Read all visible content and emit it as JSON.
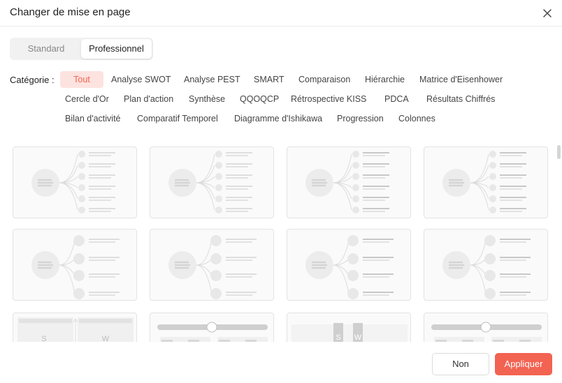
{
  "dialog": {
    "title": "Changer de mise en page"
  },
  "tabs": {
    "standard": "Standard",
    "professional": "Professionnel"
  },
  "categories": {
    "label": "Catégorie",
    "items": [
      "Tout",
      "Analyse SWOT",
      "Analyse PEST",
      "SMART",
      "Comparaison",
      "Hiérarchie",
      "Matrice d'Eisenhower",
      "Cercle d'Or",
      "Plan d'action",
      "Synthèse",
      "QQOQCP",
      "Rétrospective KISS",
      "PDCA",
      "Résultats Chiffrés",
      "Bilan d'activité",
      "Comparatif Temporel",
      "Diagramme d'Ishikawa",
      "Progression",
      "Colonnes"
    ],
    "active": "Tout"
  },
  "thumbnails": {
    "rows": [
      [
        "mindmap-6",
        "mindmap-6",
        "mindmap-6",
        "mindmap-6"
      ],
      [
        "mindmap-4",
        "mindmap-4",
        "mindmap-4",
        "mindmap-4"
      ],
      [
        "swot-columns",
        "timeline-slider",
        "swot-columns",
        "timeline-slider"
      ]
    ],
    "swot_letters": [
      "S",
      "W"
    ]
  },
  "footer": {
    "cancel": "Non",
    "apply": "Appliquer"
  },
  "colors": {
    "accent": "#f26352",
    "accent_bg": "#fde3df"
  }
}
